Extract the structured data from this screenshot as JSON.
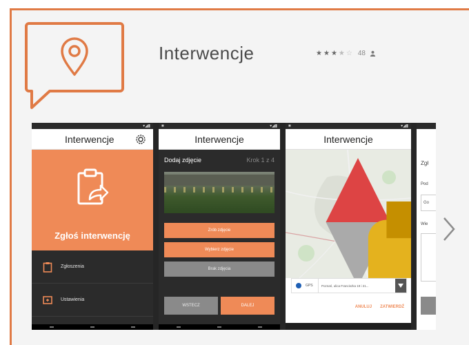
{
  "app": {
    "title": "Interwencje",
    "rating_count": "48",
    "stars_filled": 3,
    "stars_total": 5
  },
  "colors": {
    "accent": "#ef8a57",
    "border": "#e07a45",
    "dark": "#2b2b2b"
  },
  "screenshot1": {
    "title": "Interwencje",
    "hero_label": "Zgłoś interwencję",
    "menu": [
      {
        "label": "Zgłoszenia",
        "icon": "clipboard-icon"
      },
      {
        "label": "Ustawienia",
        "icon": "settings-card-icon"
      }
    ]
  },
  "screenshot2": {
    "title": "Interwencje",
    "heading": "Dodaj zdjęcie",
    "step": "Krok 1 z 4",
    "buttons": {
      "take_photo": "Zrób zdjęcie",
      "choose_photo": "Wybierz zdjęcie",
      "no_photo": "Brak zdjęcia"
    },
    "back": "WSTECZ",
    "next": "DALEJ"
  },
  "screenshot3": {
    "title": "Interwencje",
    "gps_label": "GPS",
    "address": "Poznań, ulica Franciszka 19 i 21...",
    "cancel": "ANULUJ",
    "confirm": "ZATWIERDŹ"
  },
  "screenshot4": {
    "title_fragment": "Zgł",
    "label1": "Pod",
    "field1": "Go",
    "label2": "Wie"
  }
}
